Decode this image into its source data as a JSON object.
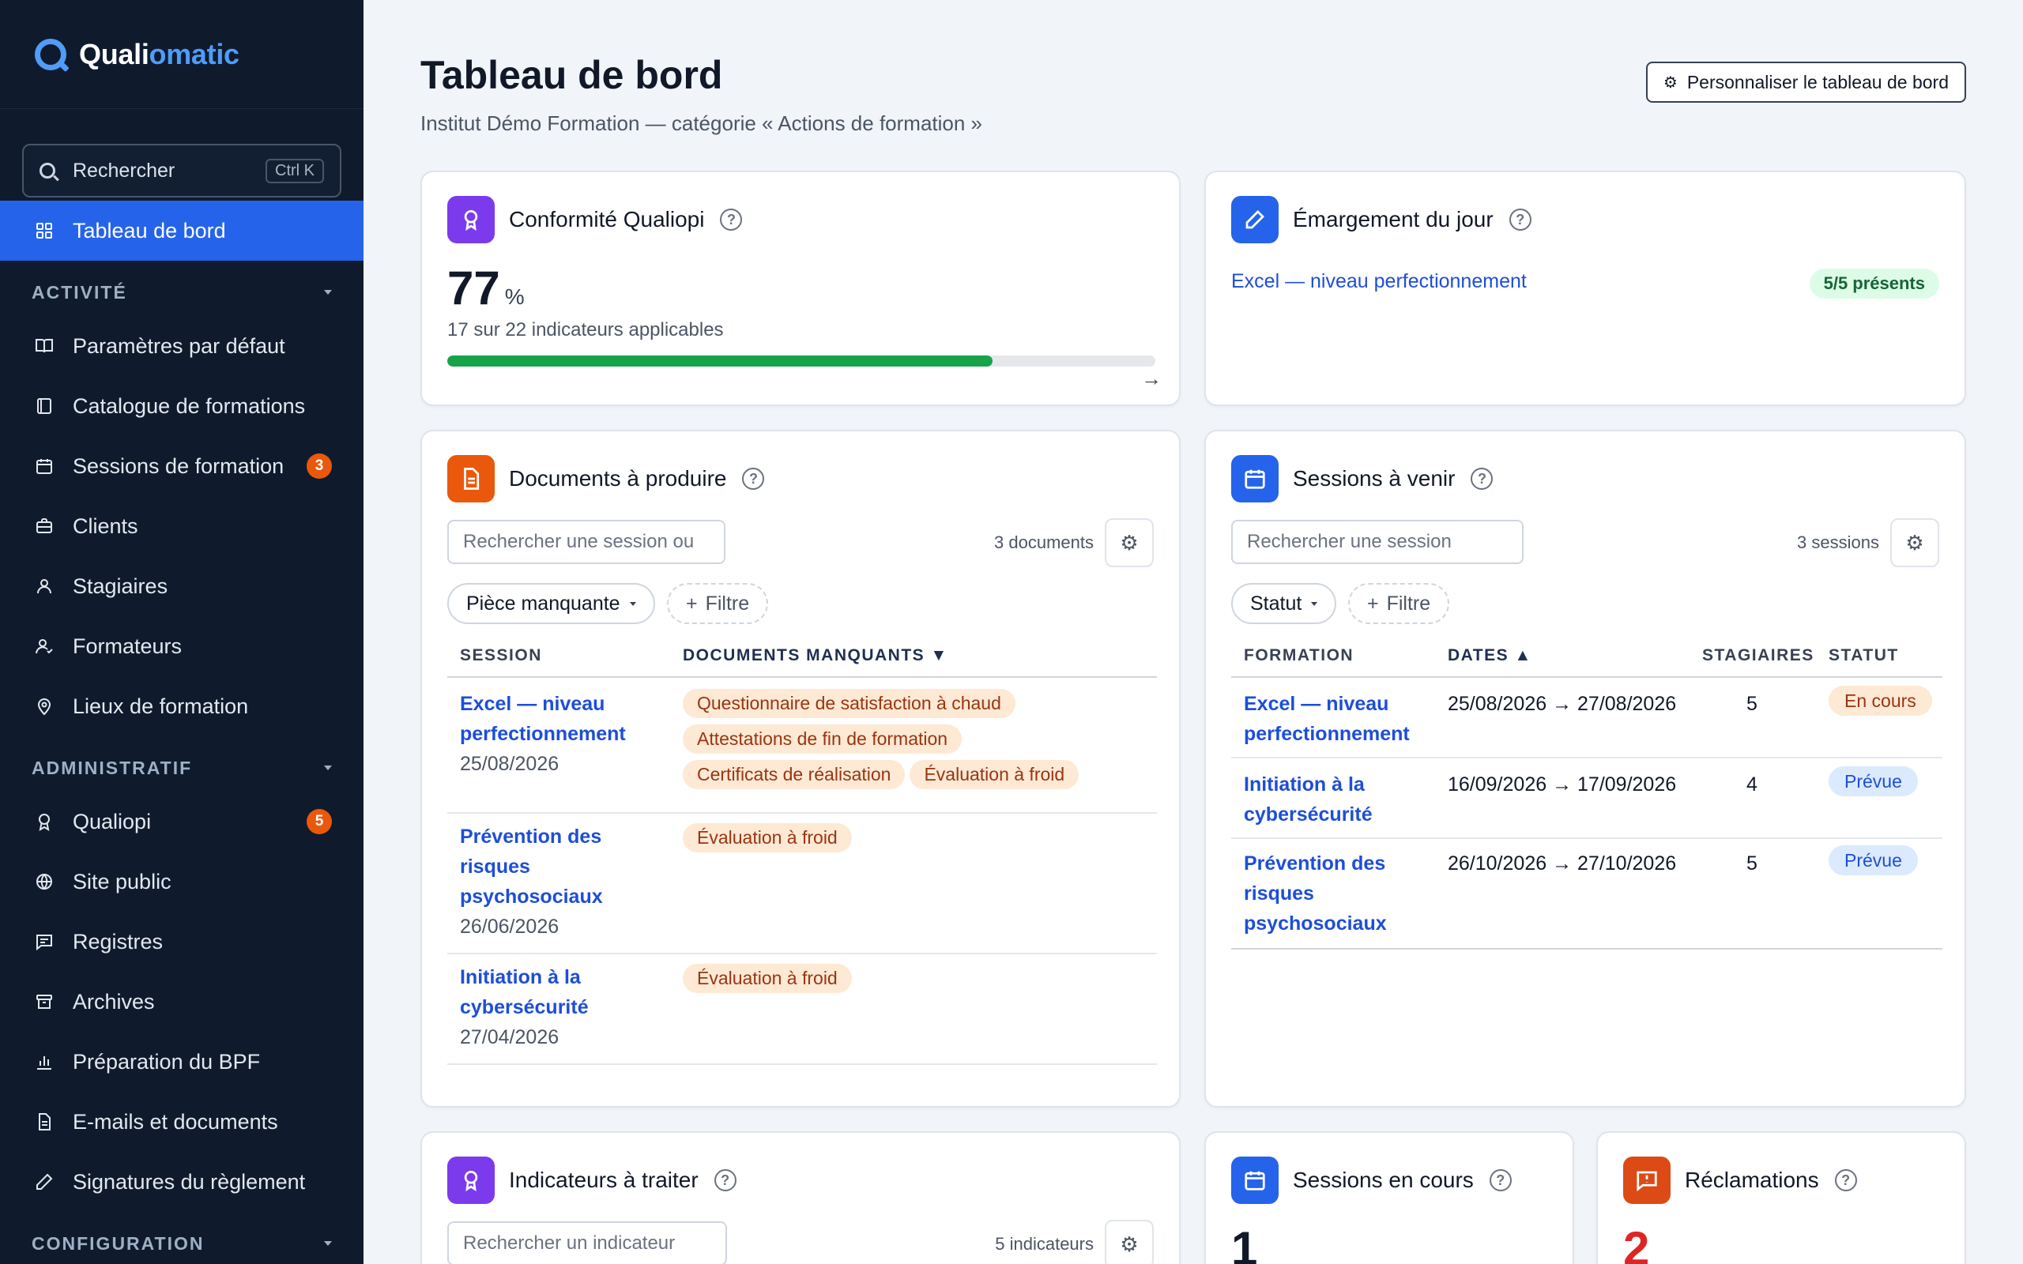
{
  "app": {
    "name_part1": "Quali",
    "name_part2": "omatic"
  },
  "sidebar": {
    "search_label": "Rechercher",
    "search_shortcut": "Ctrl K",
    "active_item": "Tableau de bord",
    "sections": {
      "activite": "ACTIVITÉ",
      "administratif": "ADMINISTRATIF",
      "configuration": "CONFIGURATION"
    },
    "items": {
      "parametres": "Paramètres par défaut",
      "catalogue": "Catalogue de formations",
      "sessions": "Sessions de formation",
      "sessions_badge": "3",
      "clients": "Clients",
      "stagiaires": "Stagiaires",
      "formateurs": "Formateurs",
      "lieux": "Lieux de formation",
      "qualiopi": "Qualiopi",
      "qualiopi_badge": "5",
      "site_public": "Site public",
      "registres": "Registres",
      "archives": "Archives",
      "bpf": "Préparation du BPF",
      "emails": "E-mails et documents",
      "signatures": "Signatures du règlement"
    }
  },
  "header": {
    "title": "Tableau de bord",
    "subtitle": "Institut Démo Formation — catégorie « Actions de formation »",
    "customize_label": "Personnaliser le tableau de bord"
  },
  "conformite": {
    "title": "Conformité Qualiopi",
    "value": "77",
    "unit": "%",
    "detail": "17 sur 22 indicateurs applicables",
    "progress": 0.77,
    "arrow": "→"
  },
  "emargement": {
    "title": "Émargement du jour",
    "session": "Excel — niveau perfectionnement",
    "presence": "5/5 présents"
  },
  "documents": {
    "title": "Documents à produire",
    "search_placeholder": "Rechercher une session ou",
    "count": "3 documents",
    "filter_chip": "Pièce manquante",
    "add_filter": "Filtre",
    "col_session": "SESSION",
    "col_docs": "DOCUMENTS MANQUANTS ▼",
    "rows": [
      {
        "name_l1": "Excel — niveau",
        "name_l2": "perfectionnement",
        "date": "25/08/2026",
        "tags": [
          "Questionnaire de satisfaction à chaud",
          "Attestations de fin de formation",
          "Certificats de réalisation",
          "Évaluation à froid"
        ]
      },
      {
        "name_l1": "Prévention des",
        "name_l2": "risques",
        "name_l3": "psychosociaux",
        "date": "26/06/2026",
        "tags": [
          "Évaluation à froid"
        ]
      },
      {
        "name_l1": "Initiation à la",
        "name_l2": "cybersécurité",
        "date": "27/04/2026",
        "tags": [
          "Évaluation à froid"
        ]
      }
    ]
  },
  "sessions_avenir": {
    "title": "Sessions à venir",
    "search_placeholder": "Rechercher une session",
    "count": "3 sessions",
    "filter_chip": "Statut",
    "add_filter": "Filtre",
    "col_formation": "FORMATION",
    "col_dates": "DATES ▲",
    "col_stagiaires": "STAGIAIRES",
    "col_statut": "STATUT",
    "rows": [
      {
        "name_l1": "Excel — niveau",
        "name_l2": "perfectionnement",
        "dates": "25/08/2026 → 27/08/2026",
        "stagiaires": "5",
        "statut": "En cours"
      },
      {
        "name_l1": "Initiation à la",
        "name_l2": "cybersécurité",
        "dates": "16/09/2026 → 17/09/2026",
        "stagiaires": "4",
        "statut": "Prévue"
      },
      {
        "name_l1": "Prévention des",
        "name_l2": "risques",
        "name_l3": "psychosociaux",
        "dates": "26/10/2026 → 27/10/2026",
        "stagiaires": "5",
        "statut": "Prévue"
      }
    ]
  },
  "indicateurs": {
    "title": "Indicateurs à traiter",
    "search_placeholder": "Rechercher un indicateur",
    "count": "5 indicateurs"
  },
  "sessions_cours": {
    "title": "Sessions en cours",
    "value": "1"
  },
  "reclamations": {
    "title": "Réclamations",
    "value": "2"
  },
  "colors": {
    "sidebar_bg": "#0f1b2d",
    "active": "#2563eb",
    "accent": "#4f9cf9",
    "success": "#16a34a",
    "badge": "#ea580c",
    "danger": "#dc2626"
  }
}
